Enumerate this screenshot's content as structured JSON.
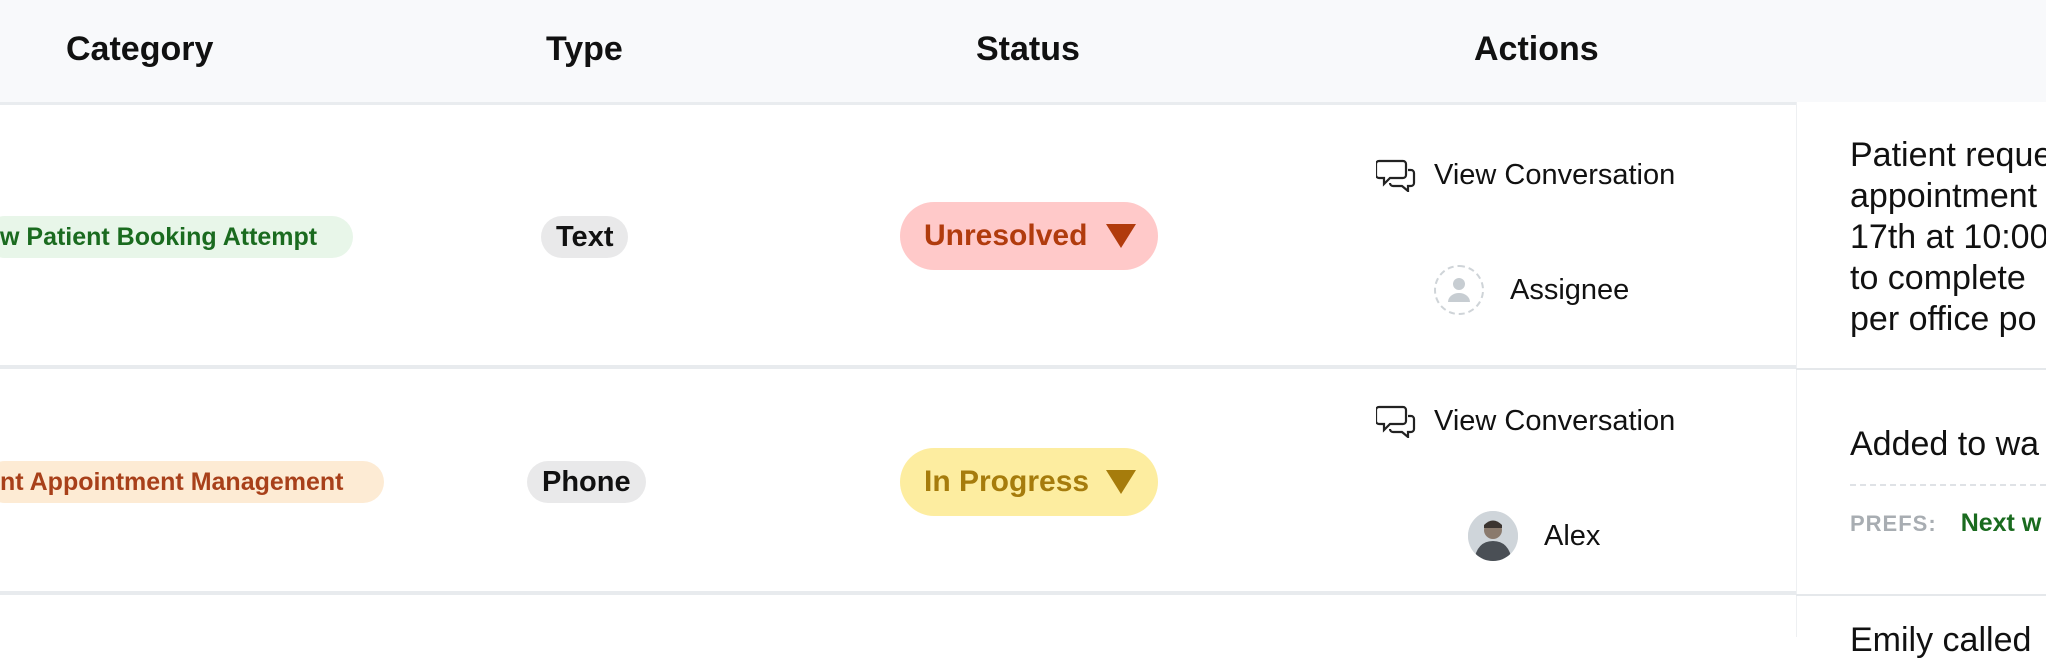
{
  "headers": {
    "category": "Category",
    "type": "Type",
    "status": "Status",
    "actions": "Actions"
  },
  "rows": [
    {
      "category": "w Patient Booking Attempt",
      "type": "Text",
      "status": "Unresolved",
      "view_label": "View Conversation",
      "assignee": "Assignee",
      "note_lines": [
        "Patient reque",
        "appointment",
        "17th at 10:00",
        "to complete",
        "per office po"
      ]
    },
    {
      "category": "nt Appointment Management",
      "type": "Phone",
      "status": "In Progress",
      "view_label": "View Conversation",
      "assignee": "Alex",
      "note_lines": [
        "Added to wa"
      ],
      "prefs_label": "PREFS:",
      "prefs_value": "Next w"
    }
  ],
  "row3_note": "Emily called",
  "colors": {
    "unresolved_bg": "#ffc9c9",
    "unresolved_text": "#b13b0d",
    "in_progress_bg": "#fdeda0",
    "in_progress_text": "#a67c0c",
    "category_green": "#1a6b1f",
    "category_orange": "#a8401a"
  },
  "icons": [
    "chat-bubbles-icon",
    "person-placeholder-icon",
    "caret-down-icon"
  ]
}
